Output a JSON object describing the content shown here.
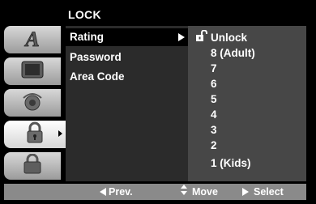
{
  "title": "LOCK",
  "icons": [
    {
      "name": "language-icon",
      "glyph": "A"
    },
    {
      "name": "display-icon"
    },
    {
      "name": "audio-icon"
    },
    {
      "name": "lock-icon",
      "active": true
    },
    {
      "name": "others-icon"
    }
  ],
  "menu": [
    {
      "label": "Rating",
      "selected": true
    },
    {
      "label": "Password"
    },
    {
      "label": "Area Code"
    }
  ],
  "rating_options": [
    "Unlock",
    "8 (Adult)",
    "7",
    "6",
    "5",
    "4",
    "3",
    "2",
    "1 (Kids)"
  ],
  "bottom": {
    "prev": "Prev.",
    "move": "Move",
    "select": "Select"
  }
}
